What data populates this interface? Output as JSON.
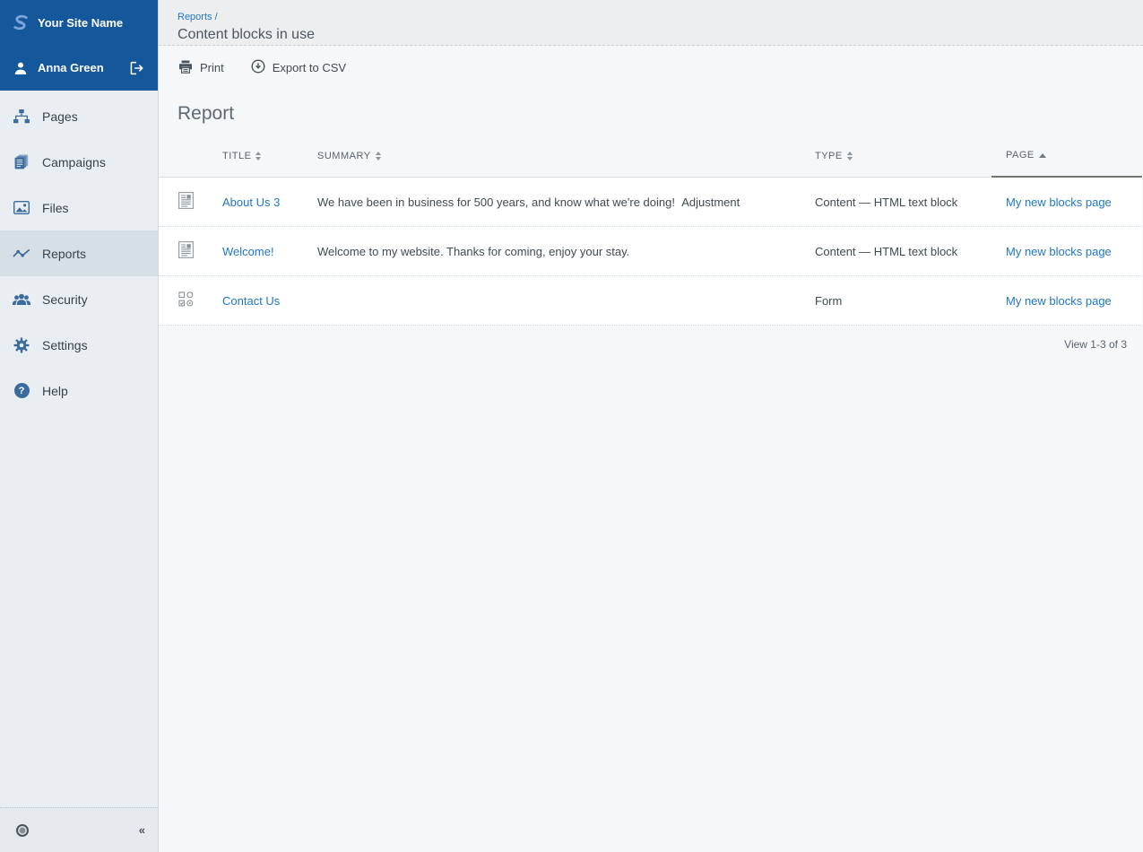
{
  "sidebar": {
    "site_name": "Your Site Name",
    "user_name": "Anna Green",
    "items": [
      {
        "label": "Pages",
        "icon": "sitemap-icon",
        "active": false
      },
      {
        "label": "Campaigns",
        "icon": "documents-icon",
        "active": false
      },
      {
        "label": "Files",
        "icon": "image-icon",
        "active": false
      },
      {
        "label": "Reports",
        "icon": "line-chart-icon",
        "active": true
      },
      {
        "label": "Security",
        "icon": "users-icon",
        "active": false
      },
      {
        "label": "Settings",
        "icon": "gear-icon",
        "active": false
      },
      {
        "label": "Help",
        "icon": "question-icon",
        "active": false
      }
    ],
    "help_glyph": "?",
    "collapse_label": "«"
  },
  "header": {
    "breadcrumb": "Reports /",
    "title": "Content blocks in use"
  },
  "toolbar": {
    "print_label": "Print",
    "export_label": "Export to CSV"
  },
  "report": {
    "heading": "Report",
    "columns": [
      {
        "label": "TITLE",
        "sort": "both"
      },
      {
        "label": "SUMMARY",
        "sort": "both"
      },
      {
        "label": "TYPE",
        "sort": "both"
      },
      {
        "label": "PAGE",
        "sort": "asc"
      }
    ],
    "rows": [
      {
        "icon": "text-block-icon",
        "title": "About Us 3",
        "summary": "We have been in business for 500 years, and know what we're doing!  Adjustment",
        "type": "Content — HTML text block",
        "page": "My new blocks page"
      },
      {
        "icon": "text-block-icon",
        "title": "Welcome!",
        "summary": "Welcome to my website. Thanks for coming, enjoy your stay.",
        "type": "Content — HTML text block",
        "page": "My new blocks page"
      },
      {
        "icon": "form-icon",
        "title": "Contact Us",
        "summary": "",
        "type": "Form",
        "page": "My new blocks page"
      }
    ],
    "pagination": "View 1-3 of 3"
  },
  "colors": {
    "header_blue": "#15579b",
    "link_blue": "#2077c8",
    "icon_blue": "#3c6b9d",
    "sidebar_bg": "#e9eef2",
    "active_item_bg": "#d7dfe6",
    "main_bg": "#f5f7f8",
    "sorted_underline": "#70756f"
  }
}
